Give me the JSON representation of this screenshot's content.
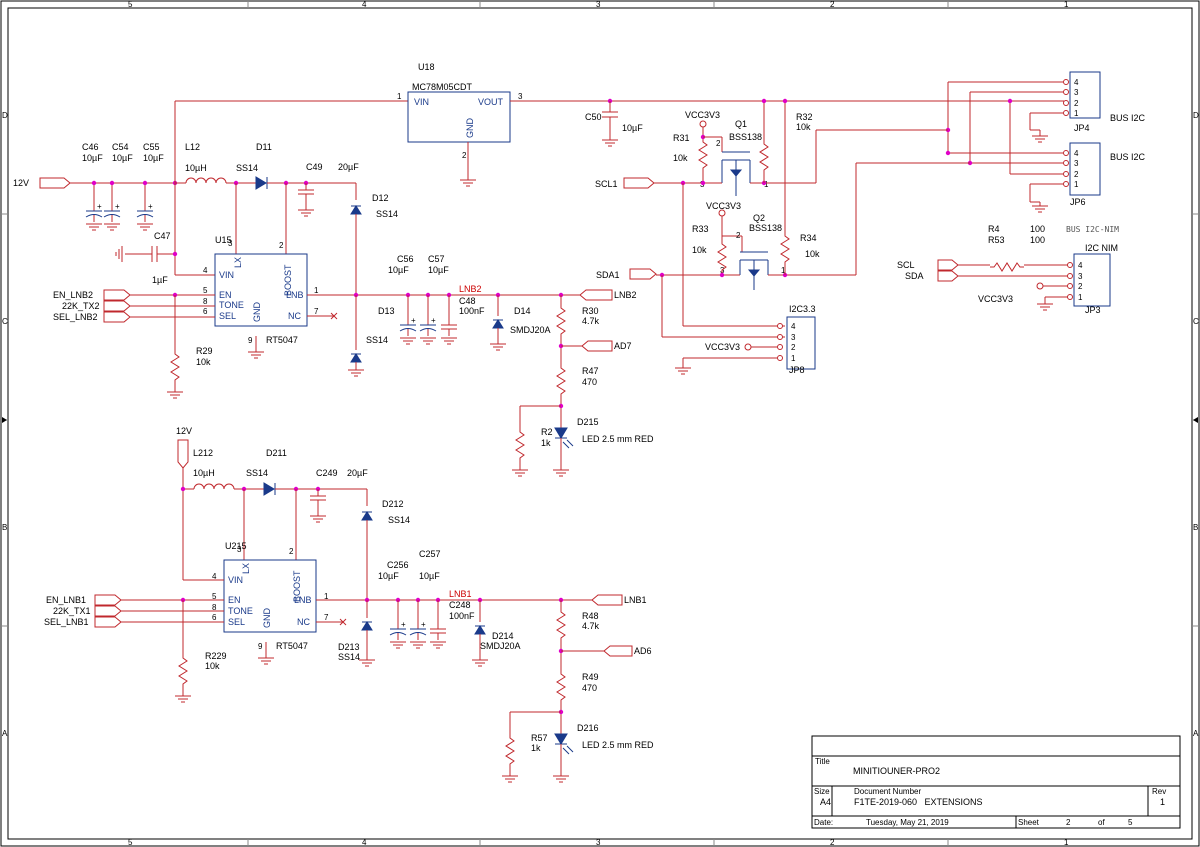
{
  "frame": {
    "columns": [
      "5",
      "4",
      "3",
      "2",
      "1"
    ],
    "rows": [
      "D",
      "C",
      "B",
      "A"
    ]
  },
  "title_block": {
    "title_label": "Title",
    "title": "MINITIOUNER-PRO2",
    "size_label": "Size",
    "size": "A4",
    "docnum_label": "Document Number",
    "docnum": "F1TE-2019-060   EXTENSIONS",
    "rev_label": "Rev",
    "rev": "1",
    "date_label": "Date:",
    "date": "Tuesday, May 21, 2019",
    "sheet_label": "Sheet",
    "sheet": "2",
    "of_label": "of",
    "of": "5"
  },
  "regulator": {
    "ref": "U18",
    "part": "MC78M05CDT",
    "pin_vin": "VIN",
    "pin_vout": "VOUT",
    "pin_gnd": "GND",
    "n1": "1",
    "n2": "2",
    "n3": "3"
  },
  "input": {
    "net_12v": "12V",
    "caps": [
      {
        "ref": "C46",
        "val": "10µF"
      },
      {
        "ref": "C54",
        "val": "10µF"
      },
      {
        "ref": "C55",
        "val": "10µF"
      }
    ],
    "c47": {
      "ref": "C47",
      "val": "1µF"
    }
  },
  "lnb2": {
    "l": {
      "ref": "L12",
      "val": "10µH"
    },
    "d11": {
      "ref": "D11",
      "val": "SS14"
    },
    "c49": {
      "ref": "C49",
      "val": "20µF"
    },
    "d12": {
      "ref": "D12",
      "val": "SS14"
    },
    "ic": {
      "ref": "U15",
      "part": "RT5047",
      "vin": "VIN",
      "lx": "LX",
      "boost": "BOOST",
      "lnb": "LNB",
      "en": "EN",
      "tone": "TONE",
      "sel": "SEL",
      "gnd": "GND",
      "nc": "NC",
      "p1": "1",
      "p2": "2",
      "p3": "3",
      "p4": "4",
      "p5": "5",
      "p6": "6",
      "p7": "7",
      "p8": "8",
      "p9": "9"
    },
    "ports": [
      "EN_LNB2",
      "22K_TX2",
      "SEL_LNB2"
    ],
    "r29": {
      "ref": "R29",
      "val": "10k"
    },
    "d13": {
      "ref": "D13",
      "val": "SS14"
    },
    "c56": {
      "ref": "C56",
      "val": "10µF"
    },
    "c57": {
      "ref": "C57",
      "val": "10µF"
    },
    "c48": {
      "ref": "C48",
      "val": "100nF"
    },
    "net": "LNB2",
    "d14": {
      "ref": "D14",
      "val": "SMDJ20A"
    },
    "r30": {
      "ref": "R30",
      "val": "4.7k"
    },
    "port_lnb": "LNB2",
    "port_ad": "AD7",
    "r47": {
      "ref": "R47",
      "val": "470"
    },
    "r2": {
      "ref": "R2",
      "val": "1k"
    },
    "led": {
      "ref": "D215",
      "val": "LED 2.5 mm RED"
    }
  },
  "lnb1": {
    "net_12v": "12V",
    "l": {
      "ref": "L212",
      "val": "10µH"
    },
    "d": {
      "ref": "D211",
      "val": "SS14"
    },
    "c": {
      "ref": "C249",
      "val": "20µF"
    },
    "d2": {
      "ref": "D212",
      "val": "SS14"
    },
    "ic": {
      "ref": "U215",
      "part": "RT5047",
      "vin": "VIN",
      "lx": "LX",
      "boost": "BOOST",
      "lnb": "LNB",
      "en": "EN",
      "tone": "TONE",
      "sel": "SEL",
      "gnd": "GND",
      "nc": "NC",
      "p1": "1",
      "p2": "2",
      "p3": "3",
      "p4": "4",
      "p5": "5",
      "p6": "6",
      "p7": "7",
      "p8": "8",
      "p9": "9"
    },
    "ports": [
      "EN_LNB1",
      "22K_TX1",
      "SEL_LNB1"
    ],
    "r229": {
      "ref": "R229",
      "val": "10k"
    },
    "d213": {
      "ref": "D213",
      "val": "SS14"
    },
    "c256": {
      "ref": "C256",
      "val": "10µF"
    },
    "c257": {
      "ref": "C257",
      "val": "10µF"
    },
    "c248": {
      "ref": "C248",
      "val": "100nF"
    },
    "net": "LNB1",
    "d214": {
      "ref": "D214",
      "val": "SMDJ20A"
    },
    "r48": {
      "ref": "R48",
      "val": "4.7k"
    },
    "port_lnb": "LNB1",
    "port_ad": "AD6",
    "r49": {
      "ref": "R49",
      "val": "470"
    },
    "r57": {
      "ref": "R57",
      "val": "1k"
    },
    "led": {
      "ref": "D216",
      "val": "LED 2.5 mm RED"
    }
  },
  "i2c": {
    "c50": {
      "ref": "C50",
      "val": "10µF"
    },
    "vcc": "VCC3V3",
    "q1": {
      "ref": "Q1",
      "val": "BSS138"
    },
    "q2": {
      "ref": "Q2",
      "val": "BSS138"
    },
    "r31": {
      "ref": "R31",
      "val": "10k"
    },
    "r32": {
      "ref": "R32",
      "val": "10k"
    },
    "r33": {
      "ref": "R33",
      "val": "10k"
    },
    "r34": {
      "ref": "R34",
      "val": "10k"
    },
    "scl": "SCL1",
    "sda": "SDA1",
    "jp4": {
      "ref": "JP4",
      "label": "BUS I2C"
    },
    "jp6": {
      "ref": "JP6",
      "label": "BUS I2C"
    },
    "jp8": {
      "ref": "JP8",
      "label": "I2C3.3"
    },
    "jp3": {
      "ref": "JP3",
      "label": "I2C NIM"
    },
    "r4": {
      "ref": "R4",
      "val": "100"
    },
    "r53": {
      "ref": "R53",
      "val": "100"
    },
    "nim_scl": "SCL",
    "nim_sda": "SDA",
    "bus_nim": "BUS I2C-NIM",
    "pins": [
      "4",
      "3",
      "2",
      "1"
    ]
  }
}
